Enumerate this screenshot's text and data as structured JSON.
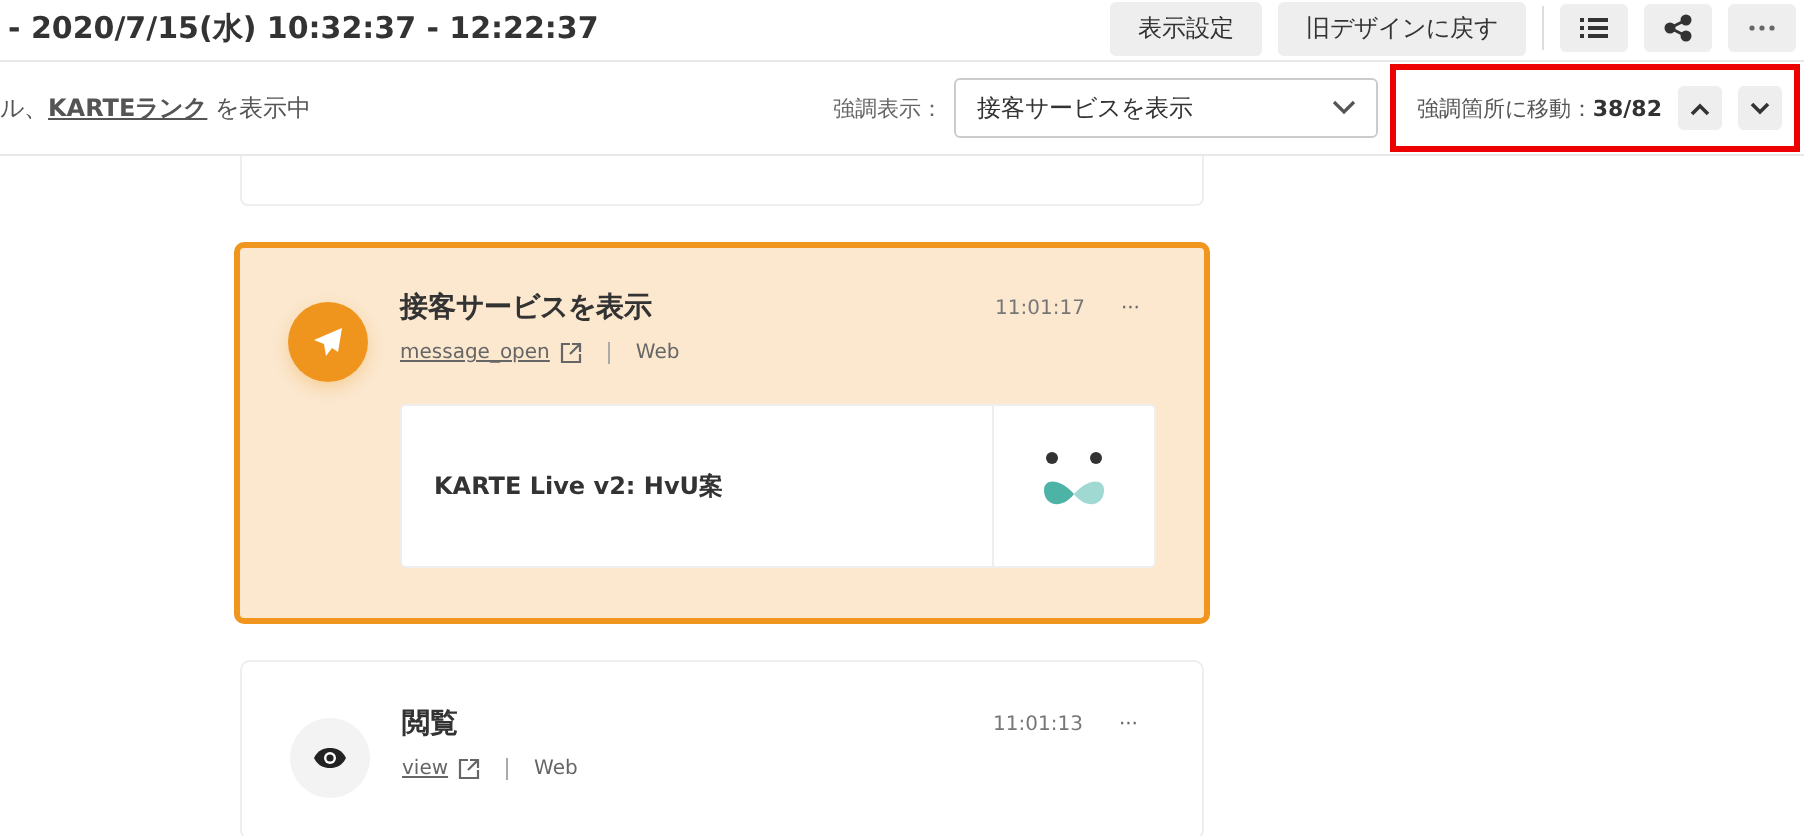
{
  "header": {
    "period": "- 2020/7/15(水) 10:32:37 - 12:22:37",
    "buttons": [
      {
        "label": "表示設定"
      },
      {
        "label": "旧デザインに戻す"
      }
    ],
    "icon_buttons": [
      {
        "kind": "list"
      },
      {
        "kind": "share"
      },
      {
        "kind": "more"
      }
    ]
  },
  "toolbar": {
    "shown_prefix": "ル、",
    "shown_link": "KARTEランク",
    "shown_suffix": "を表示中",
    "emphasis_label": "強調表示：",
    "emphasis_value": "接客サービスを表示",
    "jump_label": "強調箇所に移動：",
    "jump_count": "38/82"
  },
  "events": [
    {
      "kind": "message",
      "highlighted": true,
      "title": "接客サービスを表示",
      "event_link": "message_open",
      "channel": "Web",
      "time": "11:01:17",
      "more": "···",
      "attachment": {
        "title": "KARTE Live v2: HvU案"
      }
    },
    {
      "kind": "view",
      "highlighted": false,
      "title": "閲覧",
      "event_link": "view",
      "channel": "Web",
      "time": "11:01:13",
      "more": "···"
    }
  ]
}
